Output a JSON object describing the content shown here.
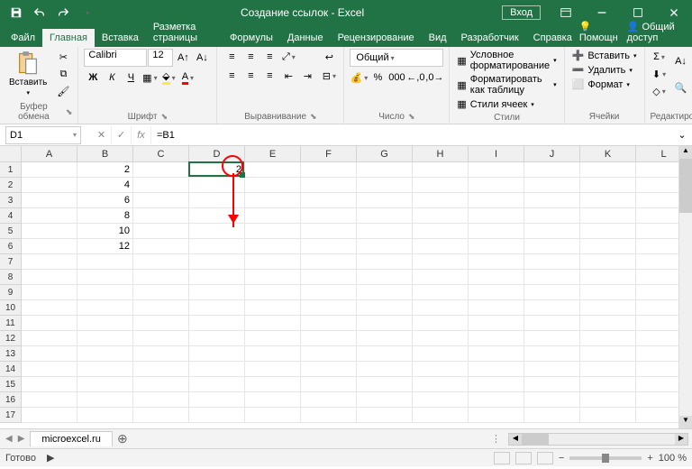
{
  "app": {
    "title": "Создание ссылок  -  Excel",
    "login": "Вход"
  },
  "tabs": {
    "file": "Файл",
    "items": [
      "Главная",
      "Вставка",
      "Разметка страницы",
      "Формулы",
      "Данные",
      "Рецензирование",
      "Вид",
      "Разработчик",
      "Справка"
    ],
    "active": 0,
    "help": "Помощн",
    "share": "Общий доступ"
  },
  "ribbon": {
    "clipboard": {
      "paste": "Вставить",
      "label": "Буфер обмена"
    },
    "font": {
      "name": "Calibri",
      "size": "12",
      "label": "Шрифт"
    },
    "align": {
      "label": "Выравнивание"
    },
    "number": {
      "format": "Общий",
      "label": "Число"
    },
    "styles": {
      "cond": "Условное форматирование",
      "table": "Форматировать как таблицу",
      "cell": "Стили ячеек",
      "label": "Стили"
    },
    "cells": {
      "insert": "Вставить",
      "delete": "Удалить",
      "format": "Формат",
      "label": "Ячейки"
    },
    "edit": {
      "label": "Редактирование"
    }
  },
  "formula": {
    "nameBox": "D1",
    "value": "=B1"
  },
  "grid": {
    "cols": [
      "A",
      "B",
      "C",
      "D",
      "E",
      "F",
      "G",
      "H",
      "I",
      "J",
      "K",
      "L"
    ],
    "rows": 17,
    "data": {
      "B1": "2",
      "B2": "4",
      "B3": "6",
      "B4": "8",
      "B5": "10",
      "B6": "12",
      "D1": "2"
    },
    "active": {
      "col": 3,
      "row": 0
    }
  },
  "sheet": {
    "name": "microexcel.ru"
  },
  "status": {
    "ready": "Готово",
    "zoom": "100 %"
  }
}
